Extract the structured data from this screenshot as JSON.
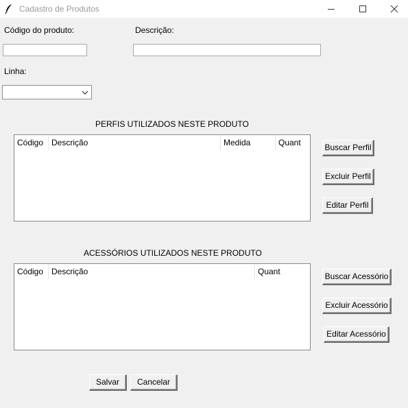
{
  "window": {
    "title": "Cadastro de Produtos",
    "controls": [
      "minimize",
      "maximize",
      "close"
    ]
  },
  "form": {
    "codigo_label": "Código do produto:",
    "codigo_value": "",
    "descricao_label": "Descrição:",
    "descricao_value": "",
    "linha_label": "Linha:",
    "linha_value": ""
  },
  "perfis": {
    "title": "PERFIS UTILIZADOS NESTE PRODUTO",
    "columns": [
      "Código",
      "Descrição",
      "Medida",
      "Quant"
    ],
    "rows": [],
    "buttons": {
      "buscar": "Buscar Perfil",
      "excluir": "Excluir Perfil",
      "editar": "Editar Perfil"
    }
  },
  "acessorios": {
    "title": "ACESSÓRIOS UTILIZADOS NESTE PRODUTO",
    "columns": [
      "Código",
      "Descrição",
      "Quant"
    ],
    "rows": [],
    "buttons": {
      "buscar": "Buscar Acessório",
      "excluir": "Excluir Acessório",
      "editar": "Editar Acessório"
    }
  },
  "footer": {
    "salvar": "Salvar",
    "cancelar": "Cancelar"
  }
}
